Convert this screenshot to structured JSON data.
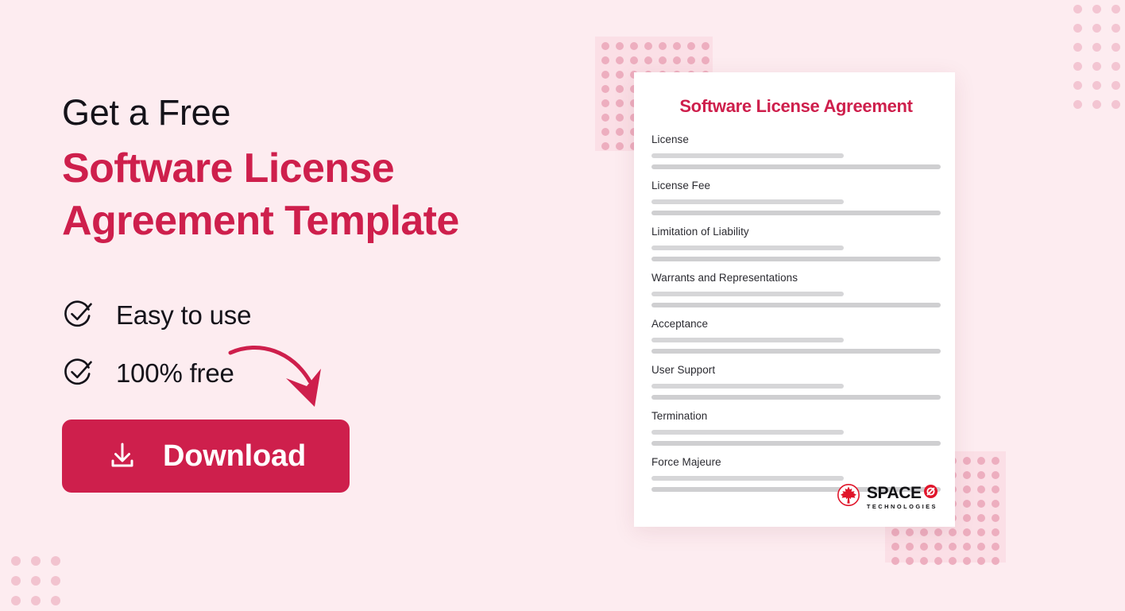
{
  "colors": {
    "background": "#fdecf0",
    "accent": "#ce1f4c",
    "dot_pink": "#edaebf",
    "dot_panel": "#fbdfe6",
    "card_background": "#ffffff",
    "bar_gray": "#d6d6d8",
    "text_dark": "#15131a"
  },
  "hero": {
    "headline_line1": "Get a Free",
    "headline_line2": "Software License Agreement Template",
    "features": [
      {
        "label": "Easy to use",
        "icon": "check-circle-icon"
      },
      {
        "label": "100% free",
        "icon": "check-circle-icon"
      }
    ],
    "download_button": {
      "label": "Download",
      "icon": "download-icon"
    },
    "arrow_icon": "curved-arrow-icon"
  },
  "document_card": {
    "title": "Software License Agreement",
    "sections": [
      {
        "title": "License"
      },
      {
        "title": "License Fee"
      },
      {
        "title": "Limitation of Liability"
      },
      {
        "title": "Warrants and Representations"
      },
      {
        "title": "Acceptance"
      },
      {
        "title": "User Support"
      },
      {
        "title": "Termination"
      },
      {
        "title": "Force Majeure"
      }
    ],
    "logo": {
      "mark_icon": "maple-leaf-icon",
      "name": "SPACE",
      "slash_icon": "slashed-circle-icon",
      "tagline": "TECHNOLOGIES"
    }
  }
}
